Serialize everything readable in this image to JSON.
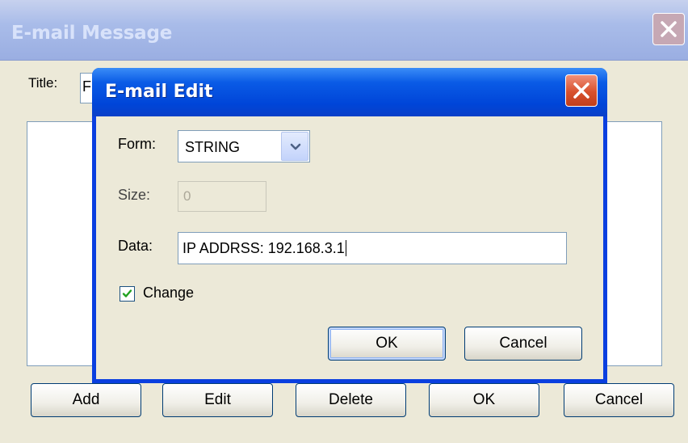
{
  "outer_window": {
    "title": "E-mail Message",
    "title_label": "Title:",
    "title_value": "F",
    "buttons": {
      "add": "Add",
      "edit": "Edit",
      "delete": "Delete",
      "ok": "OK",
      "cancel": "Cancel"
    }
  },
  "dialog": {
    "title": "E-mail Edit",
    "form_label": "Form:",
    "form_value": "STRING",
    "size_label": "Size:",
    "size_value": "0",
    "data_label": "Data:",
    "data_value": "IP ADDRSS: 192.168.3.1",
    "change_label": "Change",
    "change_checked": true,
    "ok_label": "OK",
    "cancel_label": "Cancel"
  },
  "colors": {
    "titlebar_active": "#0a5be6",
    "titlebar_inactive": "#a9bce9",
    "close_active": "#d8512d",
    "face": "#ece9d8"
  }
}
